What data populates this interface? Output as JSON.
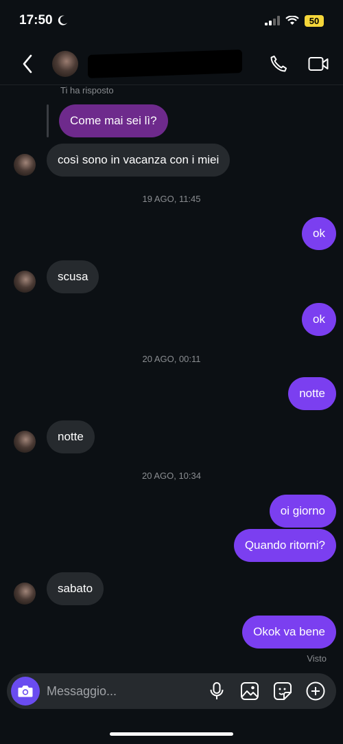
{
  "status": {
    "time": "17:50",
    "battery": "50"
  },
  "thread": {
    "replied_label": "Ti ha risposto",
    "quoted_message": "Come mai sei lì?",
    "messages": [
      {
        "side": "in",
        "text": "così sono in vacanza con i miei"
      },
      {
        "type": "timestamp",
        "text": "19 AGO, 11:45"
      },
      {
        "side": "out",
        "text": "ok"
      },
      {
        "side": "in",
        "text": "scusa"
      },
      {
        "side": "out",
        "text": "ok"
      },
      {
        "type": "timestamp",
        "text": "20 AGO, 00:11"
      },
      {
        "side": "out",
        "text": "notte"
      },
      {
        "side": "in",
        "text": "notte"
      },
      {
        "type": "timestamp",
        "text": "20 AGO, 10:34"
      },
      {
        "side": "out",
        "text": "oi giorno"
      },
      {
        "side": "out",
        "text": "Quando ritorni?"
      },
      {
        "side": "in",
        "text": "sabato"
      },
      {
        "side": "out",
        "text": "Okok va bene"
      }
    ],
    "seen_label": "Visto"
  },
  "composer": {
    "placeholder": "Messaggio..."
  },
  "colors": {
    "outgoing": "#7b3ff0",
    "incoming": "#262a2e",
    "quoted": "#6e2a8c",
    "background": "#0c1014"
  }
}
